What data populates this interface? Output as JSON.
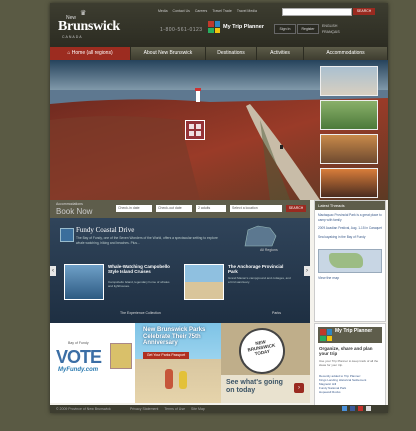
{
  "brand": {
    "prefix": "New",
    "name": "Brunswick",
    "tagline": "CANADA"
  },
  "header": {
    "top_links": [
      "Media",
      "Contact Us",
      "Careers",
      "Travel Trade",
      "Travel Media"
    ],
    "search_placeholder": "",
    "search_button": "SEARCH",
    "phone": "1-800-561-0123",
    "my_trip_planner": "My Trip Planner",
    "sign_in": "Sign In",
    "register": "Register",
    "lang": [
      "ENGLISH",
      "FRANÇAIS"
    ]
  },
  "nav": {
    "items": [
      "Home (all regions)",
      "About New Brunswick",
      "Destinations",
      "Activities",
      "Accommodations"
    ]
  },
  "booking": {
    "small": "Accommodations",
    "title": "Book Now",
    "fields": [
      "Check-in date",
      "Check-out date",
      "2 adults",
      "Select a location"
    ],
    "go": "SEARCH"
  },
  "featured": {
    "title": "Fundy Coastal Drive",
    "desc": "The Bay of Fundy, one of the Seven Wonders of the World, offers a spectacular setting to explore whale watching, hiking and beaches. Plus...",
    "map_link": "All Regions",
    "card1": {
      "title": "Whale-Watching Campobello Style Island Cruises",
      "desc": "Campobello Island, legendary home of whales and lighthouses.",
      "link": "The Experience Collection"
    },
    "card2": {
      "title": "The Anchorage Provincial Park",
      "desc": "Grand Manan's campground and cottages, and a bird sanctuary.",
      "link": "Parks"
    }
  },
  "sidebar": {
    "header": "Latest Threads",
    "items": [
      "Mactaquac Provincial Park is a great place to camp with family",
      "2009 Acadian Festival, Aug. 1-15 in Caraquet",
      "Sea kayaking in the Bay of Fundy"
    ],
    "map_link": "View the map"
  },
  "promos": {
    "vote_top": "Bay of Fundy",
    "vote": "VOTE",
    "vote_sub": "MyFundy.com",
    "parks_title": "New Brunswick Parks Celebrate Their 75th Anniversary",
    "parks_button": "Get Your Parks Passport",
    "today_logo": [
      "NEW",
      "BRUNSWICK",
      "TODAY"
    ],
    "today_text": "See what's going on today"
  },
  "trip_planner": {
    "title": "My Trip Planner",
    "organize": "Organize, share and plan your trip",
    "desc": "Use your Trip Planner to keep track of all the ideas for your trip.",
    "links": [
      "Recently added to Trip Planner:",
      "Kings Landing Historical Settlement",
      "Magnetic Hill",
      "Fundy National Park",
      "Hopewell Rocks"
    ]
  },
  "footer": {
    "copyright": "© 2009 Province of New Brunswick",
    "links": [
      "Privacy Statement",
      "Terms of Use",
      "Site Map"
    ]
  },
  "colors": {
    "accent": "#9a2a20",
    "frame": "#5a5a44",
    "nav": "#4a493a"
  }
}
